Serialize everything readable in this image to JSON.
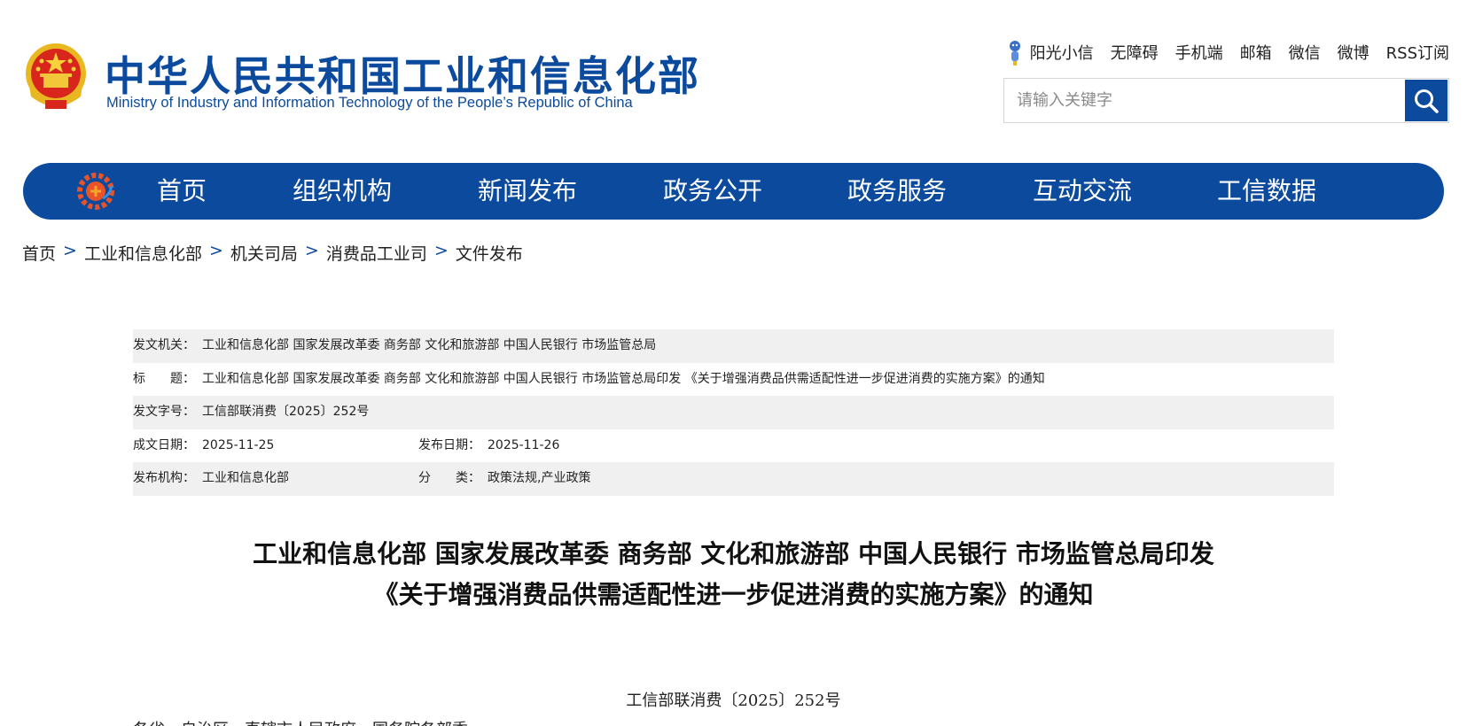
{
  "header": {
    "title": "中华人民共和国工业和信息化部",
    "subtitle": "Ministry of Industry and Information Technology of the People’s Republic of China",
    "links": [
      "阳光小信",
      "无障碍",
      "手机端",
      "邮箱",
      "微信",
      "微博",
      "RSS订阅"
    ],
    "search_placeholder": "请输入关键字"
  },
  "nav": {
    "items": [
      "首页",
      "组织机构",
      "新闻发布",
      "政务公开",
      "政务服务",
      "互动交流",
      "工信数据"
    ]
  },
  "breadcrumb": [
    "首页",
    "工业和信息化部",
    "机关司局",
    "消费品工业司",
    "文件发布"
  ],
  "breadcrumb_sep": ">",
  "meta": {
    "issuer_label": "发文机关：",
    "issuer": "工业和信息化部 国家发展改革委 商务部 文化和旅游部 中国人民银行 市场监管总局",
    "title_label": "标　　题：",
    "title": "工业和信息化部 国家发展改革委 商务部 文化和旅游部 中国人民银行 市场监管总局印发 《关于增强消费品供需适配性进一步促进消费的实施方案》的通知",
    "docno_label": "发文字号：",
    "docno": "工信部联消费〔2025〕252号",
    "written_label": "成文日期：",
    "written": "2025-11-25",
    "published_label": "发布日期：",
    "published": "2025-11-26",
    "org_label": "发布机构：",
    "org": "工业和信息化部",
    "category_label": "分　　类：",
    "category": "政策法规,产业政策"
  },
  "article": {
    "title_line1": "工业和信息化部 国家发展改革委 商务部 文化和旅游部 中国人民银行 市场监管总局印发",
    "title_line2": "《关于增强消费品供需适配性进一步促进消费的实施方案》的通知",
    "doc_number": "工信部联消费〔2025〕252号",
    "body_start": "各省、自治区、直辖市人民政府，国务院各部委"
  },
  "colors": {
    "brand_blue": "#0b4a9c",
    "meta_shade": "#f0f0f0"
  },
  "icons": [
    "national-emblem",
    "sunshine-mascot-icon",
    "search-icon",
    "miit-gear-logo"
  ]
}
